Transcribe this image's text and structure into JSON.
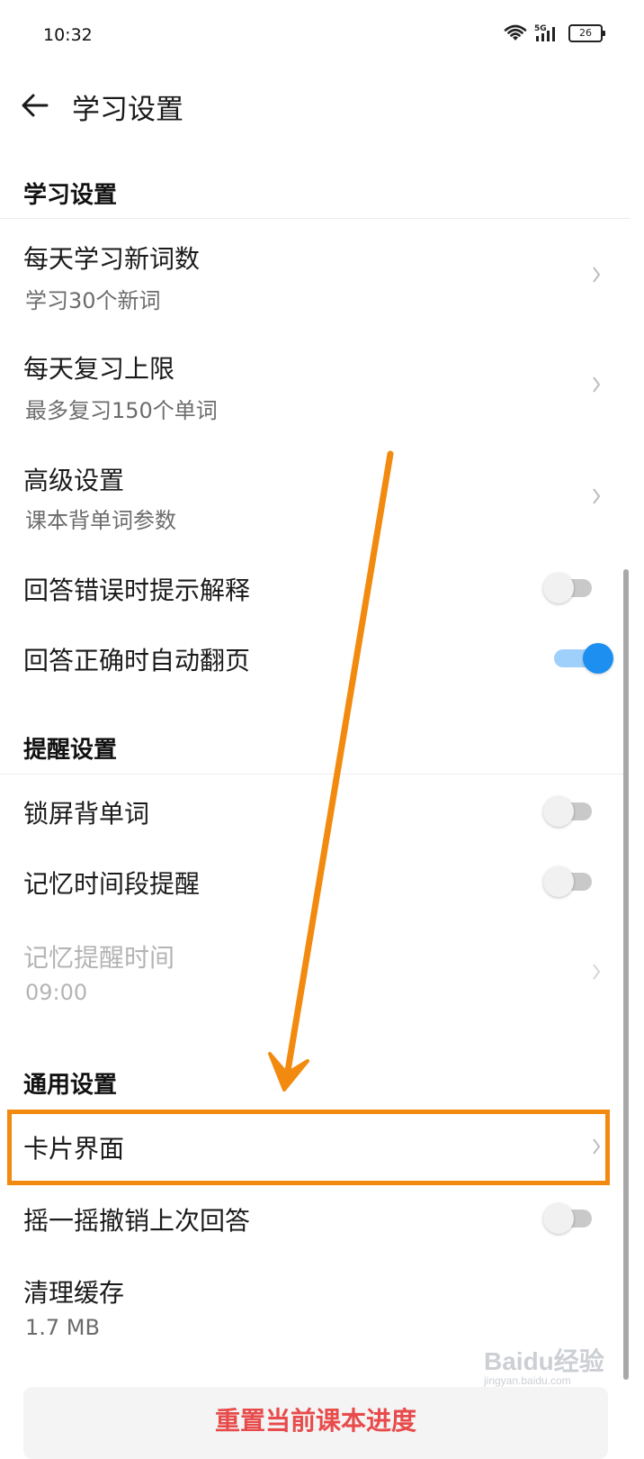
{
  "status_bar": {
    "time": "10:32",
    "network": "5G",
    "battery": "26"
  },
  "header": {
    "title": "学习设置",
    "back_icon": "arrow-left-icon"
  },
  "sections": {
    "study": {
      "header": "学习设置",
      "items": [
        {
          "title": "每天学习新词数",
          "subtitle": "学习30个新词",
          "control": "chevron"
        },
        {
          "title": "每天复习上限",
          "subtitle": "最多复习150个单词",
          "control": "chevron"
        },
        {
          "title": "高级设置",
          "subtitle": "课本背单词参数",
          "control": "chevron"
        },
        {
          "title": "回答错误时提示解释",
          "control": "toggle",
          "on": false
        },
        {
          "title": "回答正确时自动翻页",
          "control": "toggle",
          "on": true
        }
      ]
    },
    "reminder": {
      "header": "提醒设置",
      "items": [
        {
          "title": "锁屏背单词",
          "control": "toggle",
          "on": false
        },
        {
          "title": "记忆时间段提醒",
          "control": "toggle",
          "on": false
        },
        {
          "title": "记忆提醒时间",
          "subtitle": "09:00",
          "control": "chevron",
          "disabled": true
        }
      ]
    },
    "general": {
      "header": "通用设置",
      "items": [
        {
          "title": "卡片界面",
          "control": "chevron",
          "highlighted": true
        },
        {
          "title": "摇一摇撤销上次回答",
          "control": "toggle",
          "on": false
        },
        {
          "title": "清理缓存",
          "subtitle": "1.7 MB"
        }
      ]
    }
  },
  "reset_button": {
    "label": "重置当前课本进度"
  },
  "watermark": {
    "main": "Baidu经验",
    "sub": "jingyan.baidu.com"
  },
  "colors": {
    "accent": "#1c8ff0",
    "annotation": "#f28a0f",
    "danger": "#e84b4b"
  }
}
